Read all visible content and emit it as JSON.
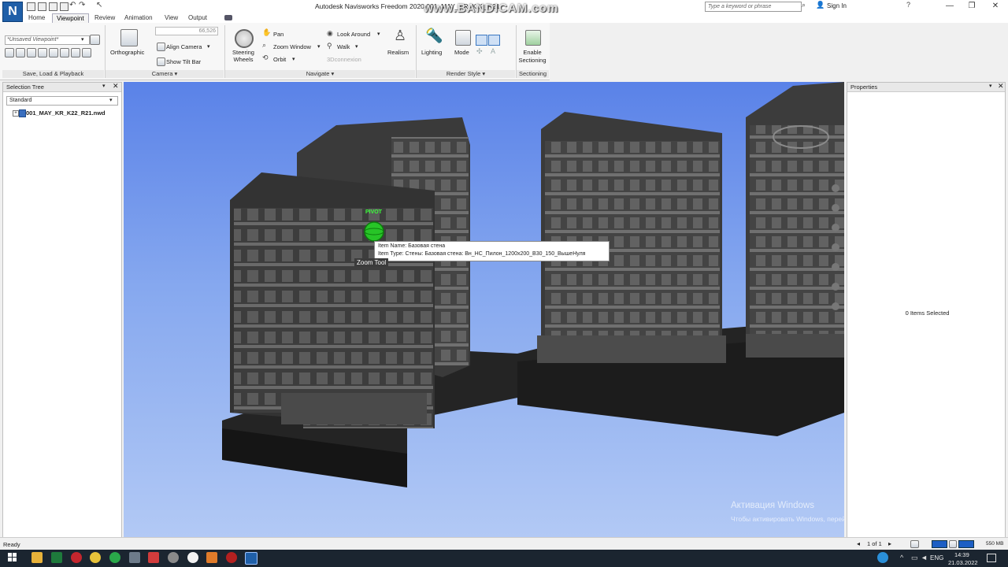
{
  "app": {
    "title": "Autodesk Navisworks Freedom 2020   001_MAY_KR_K22_R21",
    "logo_letter": "N",
    "overlay_watermark": "www.BANDICAM.com",
    "search_placeholder": "Type a keyword or phrase",
    "sign_in": "Sign In"
  },
  "tabs": [
    {
      "label": "Home"
    },
    {
      "label": "Viewpoint"
    },
    {
      "label": "Review"
    },
    {
      "label": "Animation"
    },
    {
      "label": "View"
    },
    {
      "label": "Output"
    }
  ],
  "ribbon": {
    "viewpoint_field": "*Unsaved Viewpoint*",
    "save_panel_title": "Save, Load & Playback",
    "camera": {
      "orthographic": "Orthographic",
      "fov_value": "66,526",
      "align_camera": "Align Camera",
      "show_tilt_bar": "Show Tilt Bar",
      "panel_title": "Camera"
    },
    "navigate": {
      "steering_wheels": "Steering Wheels",
      "pan": "Pan",
      "zoom_window": "Zoom Window",
      "orbit": "Orbit",
      "look_around": "Look Around",
      "walk": "Walk",
      "connexion": "3Dconnexion",
      "realism": "Realism",
      "panel_title": "Navigate"
    },
    "render_style": {
      "lighting": "Lighting",
      "mode": "Mode",
      "panel_title": "Render Style"
    },
    "sectioning": {
      "enable": "Enable Sectioning",
      "panel_title": "Sectioning"
    }
  },
  "selection_tree": {
    "title": "Selection Tree",
    "dropdown": "Standard",
    "items": [
      {
        "label": "001_MAY_KR_K22_R21.nwd"
      }
    ]
  },
  "properties": {
    "title": "Properties",
    "empty_text": "0 Items Selected"
  },
  "viewport": {
    "pivot_label": "PIVOT",
    "tooltip_line1": "Item Name: Базовая стена",
    "tooltip_line2": "Item Type: Стены: Базовая стена: Вн_НС_Пилон_1200х200_В30_150_ВышеНуля",
    "tool_hint": "Zoom Tool",
    "activation_title": "Активация Windows",
    "activation_sub": "Чтобы активировать Windows, перейдите в раздел \"Параметры\"."
  },
  "status": {
    "text": "Ready",
    "page": "1 of 1",
    "memory": "550 MB"
  },
  "taskbar": {
    "lang": "ENG",
    "time": "14:39",
    "date": "21.03.2022"
  },
  "colors": {
    "sky_top": "#5a82e8",
    "sky_bottom": "#b2c9f5",
    "pivot": "#2bd12b",
    "taskbar": "#1b2530"
  }
}
